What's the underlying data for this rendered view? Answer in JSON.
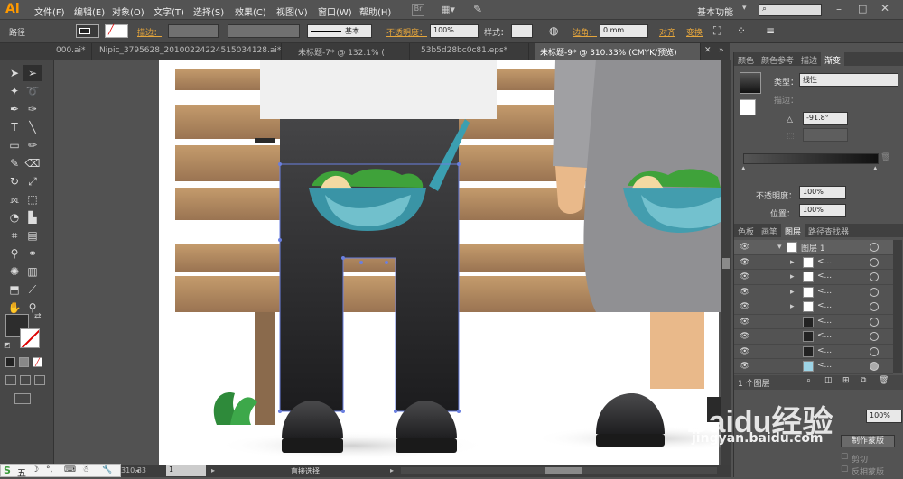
{
  "menubar": {
    "logo": "Ai",
    "items": [
      "文件(F)",
      "编辑(E)",
      "对象(O)",
      "文字(T)",
      "选择(S)",
      "效果(C)",
      "视图(V)",
      "窗口(W)",
      "帮助(H)"
    ],
    "workspace": "基本功能"
  },
  "control_bar": {
    "object_type": "路径",
    "stroke_label": "描边：",
    "brush": "基本",
    "opacity_label": "不透明度：",
    "opacity_value": "100%",
    "style_label": "样式：",
    "corner_label": "边角：",
    "corner_value": "0 mm",
    "align_label": "对齐",
    "transform_label": "变换"
  },
  "doc_tabs": [
    {
      "label": "000.ai*"
    },
    {
      "label": "Nipic_3795628_20100224224515034128.ai*"
    },
    {
      "label": "未标题-7* @ 132.1% ("
    },
    {
      "label": "53b5d28bc0c81.eps*"
    },
    {
      "label": "未标题-9* @ 310.33% (CMYK/预览)",
      "active": true
    }
  ],
  "status": {
    "zoom": "310.33",
    "artboard": "1",
    "tool": "直接选择"
  },
  "gradient_panel": {
    "tabs": [
      "颜色",
      "颜色参考",
      "描边",
      "渐变"
    ],
    "type_label": "类型：",
    "type_value": "线性",
    "stroke_label": "描边：",
    "angle_value": "-91.8°",
    "opacity_label": "不透明度：",
    "opacity_value": "100%",
    "position_label": "位置：",
    "position_value": "100%"
  },
  "layers_panel": {
    "tabs": [
      "色板",
      "画笔",
      "图层",
      "路径查找器"
    ],
    "layer_name": "图层 1",
    "rows": [
      "<...",
      "<...",
      "<...",
      "<...",
      "<...",
      "<...",
      "<...",
      "<..."
    ],
    "count_label": "1 个图层"
  },
  "lower_panel": {
    "opacity_value": "100%",
    "make_mask": "制作蒙版",
    "clip": "剪切",
    "invert_mask": "反相蒙版"
  },
  "watermark": {
    "brand": "Baidu经验",
    "url": "jingyan.baidu.com"
  },
  "taskbar": {
    "ime": "五"
  },
  "colors": {
    "bench_wood": "#b89066",
    "pants": "#2b2b2d",
    "bowl": "#3b9fb1",
    "leaves": "#3fa23a",
    "skirt": "#909093",
    "skin": "#e9b98a",
    "accent": "#e6a63c"
  }
}
